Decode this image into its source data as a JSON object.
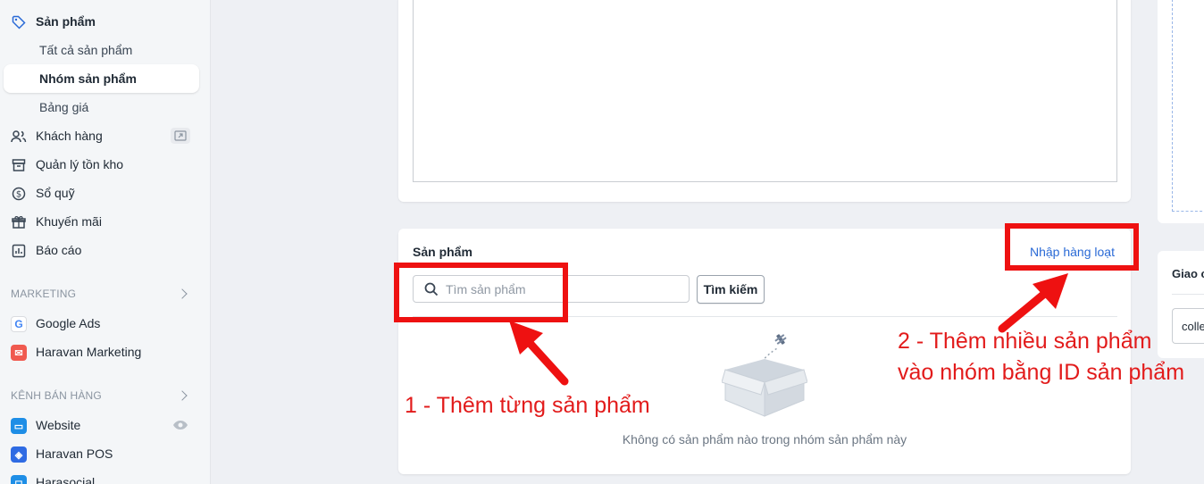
{
  "sidebar": {
    "products": "Sản phẩm",
    "all_products": "Tất cả sản phẩm",
    "product_groups": "Nhóm sản phẩm",
    "price_list": "Bảng giá",
    "customers": "Khách hàng",
    "inventory": "Quản lý tồn kho",
    "cashbook": "Sổ quỹ",
    "promotions": "Khuyến mãi",
    "reports": "Báo cáo",
    "marketing_header": "MARKETING",
    "google_ads": "Google Ads",
    "haravan_marketing": "Haravan Marketing",
    "channels_header": "KÊNH BÁN HÀNG",
    "website": "Website",
    "haravan_pos": "Haravan POS",
    "harasocial": "Harasocial"
  },
  "products_card": {
    "title": "Sản phẩm",
    "bulk_import": "Nhập hàng loạt",
    "search_placeholder": "Tìm sản phẩm",
    "search_button": "Tìm kiếm",
    "empty_message": "Không có sản phẩm nào trong nhóm sản phẩm này"
  },
  "right_panel": {
    "label": "Giao c",
    "value": "colle"
  },
  "annotations": {
    "one": "1 - Thêm từng sản phẩm",
    "two_line1": "2 - Thêm nhiều sản phẩm",
    "two_line2": "vào nhóm bằng ID sản phẩm"
  },
  "colors": {
    "annotation": "#ee1111",
    "link": "#2a6ad6",
    "brand": "#1a73e8"
  }
}
